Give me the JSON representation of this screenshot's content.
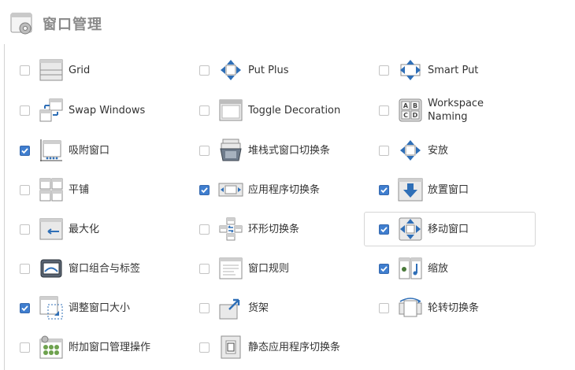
{
  "header": {
    "title": "窗口管理",
    "icon": "settings-window-icon"
  },
  "colors": {
    "accent": "#3f7ecf",
    "icon_blue": "#2f6fb7",
    "frame": "#d2d2d2"
  },
  "plugins": [
    {
      "label": "Grid",
      "checked": false,
      "icon": "grid-icon"
    },
    {
      "label": "Put Plus",
      "checked": false,
      "icon": "put-plus-icon"
    },
    {
      "label": "Smart Put",
      "checked": false,
      "icon": "smart-put-icon"
    },
    {
      "label": "Swap Windows",
      "checked": false,
      "icon": "swap-windows-icon"
    },
    {
      "label": "Toggle Decoration",
      "checked": false,
      "icon": "toggle-decoration-icon"
    },
    {
      "label": "Workspace\nNaming",
      "checked": false,
      "icon": "workspace-naming-icon"
    },
    {
      "label": "吸附窗口",
      "checked": true,
      "icon": "snap-window-icon"
    },
    {
      "label": "堆栈式窗口切换条",
      "checked": false,
      "icon": "stack-switcher-icon"
    },
    {
      "label": "安放",
      "checked": false,
      "icon": "place-icon"
    },
    {
      "label": "平铺",
      "checked": false,
      "icon": "tile-icon"
    },
    {
      "label": "应用程序切换条",
      "checked": true,
      "icon": "application-switcher-icon"
    },
    {
      "label": "放置窗口",
      "checked": true,
      "icon": "place-windows-icon"
    },
    {
      "label": "最大化",
      "checked": false,
      "icon": "maximize-icon"
    },
    {
      "label": "环形切换条",
      "checked": false,
      "icon": "ring-switcher-icon"
    },
    {
      "label": "移动窗口",
      "checked": true,
      "icon": "move-window-icon"
    },
    {
      "label": "窗口组合与标签",
      "checked": false,
      "icon": "group-tab-icon"
    },
    {
      "label": "窗口规则",
      "checked": false,
      "icon": "window-rules-icon"
    },
    {
      "label": "缩放",
      "checked": true,
      "icon": "scale-icon"
    },
    {
      "label": "调整窗口大小",
      "checked": true,
      "icon": "resize-window-icon"
    },
    {
      "label": "货架",
      "checked": false,
      "icon": "shelf-icon"
    },
    {
      "label": "轮转切换条",
      "checked": false,
      "icon": "rotate-switcher-icon"
    },
    {
      "label": "附加窗口管理操作",
      "checked": false,
      "icon": "extra-wm-actions-icon"
    },
    {
      "label": "静态应用程序切换条",
      "checked": false,
      "icon": "static-switcher-icon"
    }
  ]
}
